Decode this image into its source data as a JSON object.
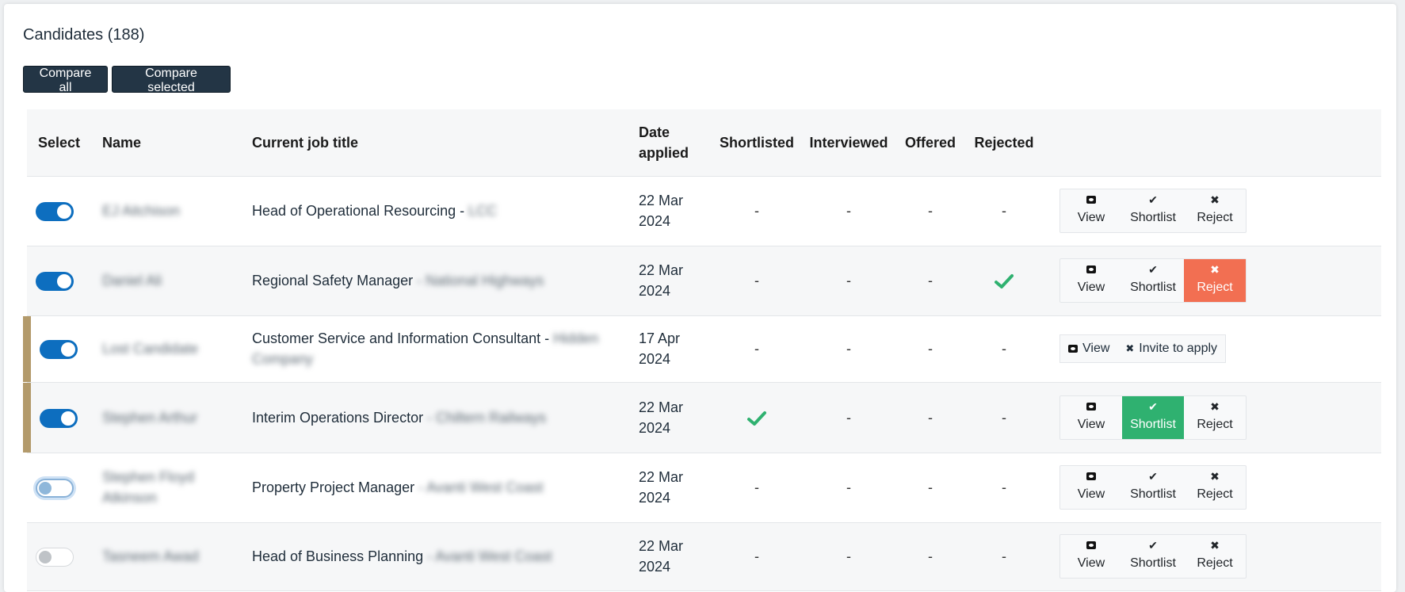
{
  "title": "Candidates (188)",
  "buttons": {
    "compare_all": "Compare all",
    "compare_selected": "Compare selected"
  },
  "columns": [
    "Select",
    "Name",
    "Current job title",
    "Date applied",
    "Shortlisted",
    "Interviewed",
    "Offered",
    "Rejected"
  ],
  "labels": {
    "view": "View",
    "shortlist": "Shortlist",
    "reject": "Reject",
    "invite": "Invite to apply",
    "dash": "-"
  },
  "colors": {
    "accent": "#0d6ebf",
    "dark": "#233545",
    "reject": "#f26f52",
    "shortlist": "#2fb170",
    "check": "#2fb170",
    "flag": "#b39a6b"
  },
  "rows": [
    {
      "name": "EJ Aitchison",
      "job": "Head of Operational Resourcing -",
      "company": "LCC",
      "date": "22 Mar 2024"
    },
    {
      "name": "Daniel Ali",
      "job": "Regional Safety Manager",
      "company": "- National Highways",
      "date": "22 Mar 2024"
    },
    {
      "name": "Lost Candidate",
      "job": "Customer Service and Information Consultant -",
      "company": "Hidden Company",
      "date": "17 Apr 2024"
    },
    {
      "name": "Stephen Arthur",
      "job": "Interim Operations Director",
      "company": "- Chiltern Railways",
      "date": "22 Mar 2024"
    },
    {
      "name": "Stephen Floyd Atkinson",
      "job": "Property Project Manager",
      "company": "- Avanti West Coast",
      "date": "22 Mar 2024"
    },
    {
      "name": "Tasneem Awad",
      "job": "Head of Business Planning",
      "company": "- Avanti West Coast",
      "date": "22 Mar 2024"
    }
  ]
}
